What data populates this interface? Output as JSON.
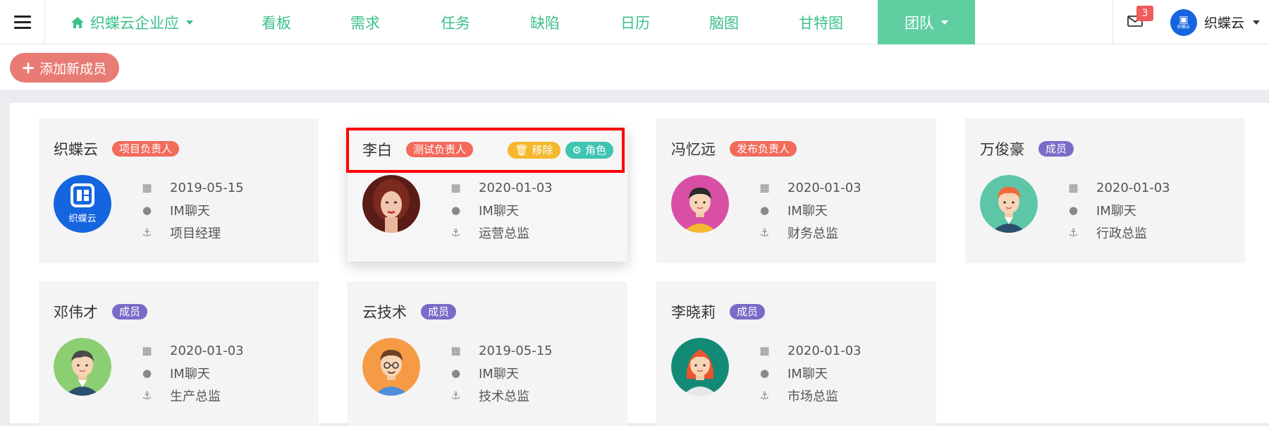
{
  "nav": {
    "brand": "织蝶云企业应",
    "links": [
      "看板",
      "需求",
      "任务",
      "缺陷",
      "日历",
      "脑图",
      "甘特图"
    ],
    "team": "团队",
    "mail_count": "3",
    "user_name": "织蝶云",
    "logo_text": "织蝶云"
  },
  "toolbar": {
    "add_member": "添加新成员"
  },
  "actions": {
    "remove": "移除",
    "role": "角色"
  },
  "members": [
    {
      "name": "织蝶云",
      "tag": "项目负责人",
      "tag_color": "#f26b5b",
      "date": "2019-05-15",
      "im": "IM聊天",
      "title": "项目经理",
      "avatar": "logo"
    },
    {
      "name": "李白",
      "tag": "测试负责人",
      "tag_color": "#f26b5b",
      "date": "2020-01-03",
      "im": "IM聊天",
      "title": "运营总监",
      "avatar": "woman-photo"
    },
    {
      "name": "冯忆远",
      "tag": "发布负责人",
      "tag_color": "#f26b5b",
      "date": "2020-01-03",
      "im": "IM聊天",
      "title": "财务总监",
      "avatar": "man-pink"
    },
    {
      "name": "万俊豪",
      "tag": "成员",
      "tag_color": "#7a6bc8",
      "date": "2020-01-03",
      "im": "IM聊天",
      "title": "行政总监",
      "avatar": "man-teal"
    },
    {
      "name": "邓伟才",
      "tag": "成员",
      "tag_color": "#7a6bc8",
      "date": "2020-01-03",
      "im": "IM聊天",
      "title": "生产总监",
      "avatar": "man-green"
    },
    {
      "name": "云技术",
      "tag": "成员",
      "tag_color": "#7a6bc8",
      "date": "2019-05-15",
      "im": "IM聊天",
      "title": "技术总监",
      "avatar": "man-orange"
    },
    {
      "name": "李晓莉",
      "tag": "成员",
      "tag_color": "#7a6bc8",
      "date": "2020-01-03",
      "im": "IM聊天",
      "title": "市场总监",
      "avatar": "woman-teal"
    }
  ],
  "colors": {
    "accent": "#3cc08a",
    "team_active": "#5fcfa2",
    "add_button": "#e87c75",
    "highlight": "#ff0000"
  }
}
